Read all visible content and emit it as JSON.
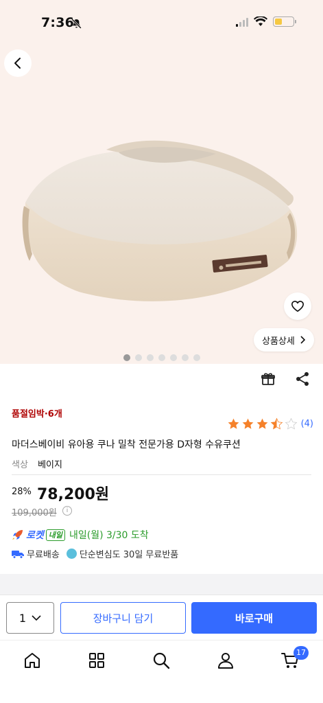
{
  "status_bar": {
    "time": "7:36"
  },
  "hero": {
    "detail_label": "상품상세",
    "image_count": 7,
    "active_image": 1
  },
  "product": {
    "stock_badge": "품절임박·6개",
    "rating": 3.5,
    "review_count": "(4)",
    "title": "마더스베이비 유아용 쿠나 밀착 전문가용 D자형 수유쿠션",
    "option_label": "색상",
    "option_value": "베이지",
    "discount": "28%",
    "price": "78,200원",
    "original_price": "109,000원"
  },
  "delivery": {
    "rocket_label": "로켓",
    "badge": "내일",
    "arrival": "내일(월) 3/30 도착",
    "free_shipping": "무료배송",
    "free_return": "단순변심도 30일 무료반품"
  },
  "bottom_bar": {
    "quantity": "1",
    "cart_label": "장바구니 담기",
    "buy_label": "바로구매"
  },
  "tab_bar": {
    "cart_count": "17"
  },
  "colors": {
    "accent": "#346aff",
    "hero_bg": "#fbf1ec",
    "sold_out": "#ae0000",
    "delivery_green": "#2a9b2a"
  }
}
